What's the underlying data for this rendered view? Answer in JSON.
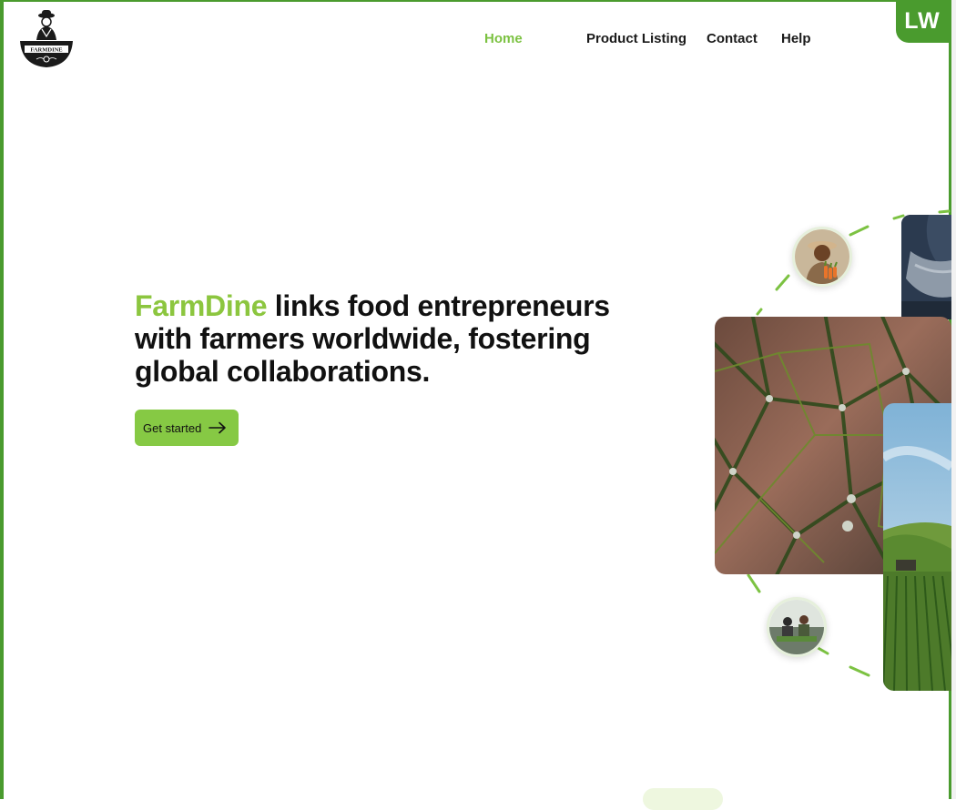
{
  "brand": {
    "name": "FARMDINE"
  },
  "nav": {
    "items": [
      {
        "label": "Home",
        "active": true
      },
      {
        "label": "Product Listing",
        "active": false
      },
      {
        "label": "Contact",
        "active": false
      },
      {
        "label": "Help",
        "active": false
      }
    ]
  },
  "user": {
    "initials": "LW"
  },
  "hero": {
    "brand_word": "FarmDine",
    "headline_rest": " links food entrepreneurs with farmers worldwide, fostering global collaborations.",
    "cta_label": "Get started"
  },
  "colors": {
    "accent": "#8cc63f",
    "button": "#86c944",
    "frame": "#4a9b2e"
  },
  "icons": {
    "cta": "arrow-right-icon",
    "logo": "farmer-logo-icon"
  }
}
